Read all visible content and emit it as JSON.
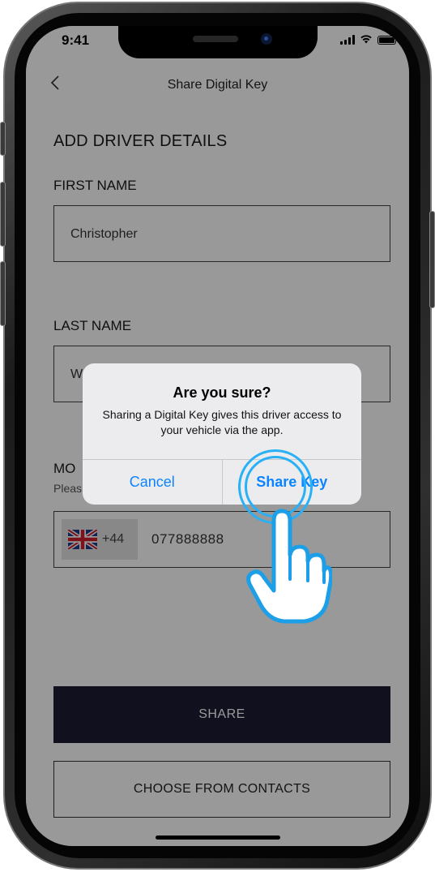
{
  "status_bar": {
    "time": "9:41"
  },
  "nav": {
    "back_icon": "chevron-left-icon",
    "title": "Share Digital Key"
  },
  "form": {
    "section_title": "ADD DRIVER DETAILS",
    "first_name": {
      "label": "FIRST NAME",
      "value": "Christopher"
    },
    "last_name": {
      "label": "LAST NAME",
      "value": "W"
    },
    "mobile": {
      "label": "MO",
      "hint": "Pleas",
      "flag_icon": "uk-flag-icon",
      "country_code": "+44",
      "value": "077888888"
    }
  },
  "buttons": {
    "share": "SHARE",
    "choose_contacts": "CHOOSE FROM CONTACTS"
  },
  "alert": {
    "title": "Are you sure?",
    "message": "Sharing a Digital Key gives this driver access to your vehicle via the app.",
    "cancel_label": "Cancel",
    "confirm_label": "Share Key"
  },
  "colors": {
    "accent": "#0a84ff",
    "share_button_bg": "#1c1c33",
    "tap_highlight": "#29b0f5"
  }
}
